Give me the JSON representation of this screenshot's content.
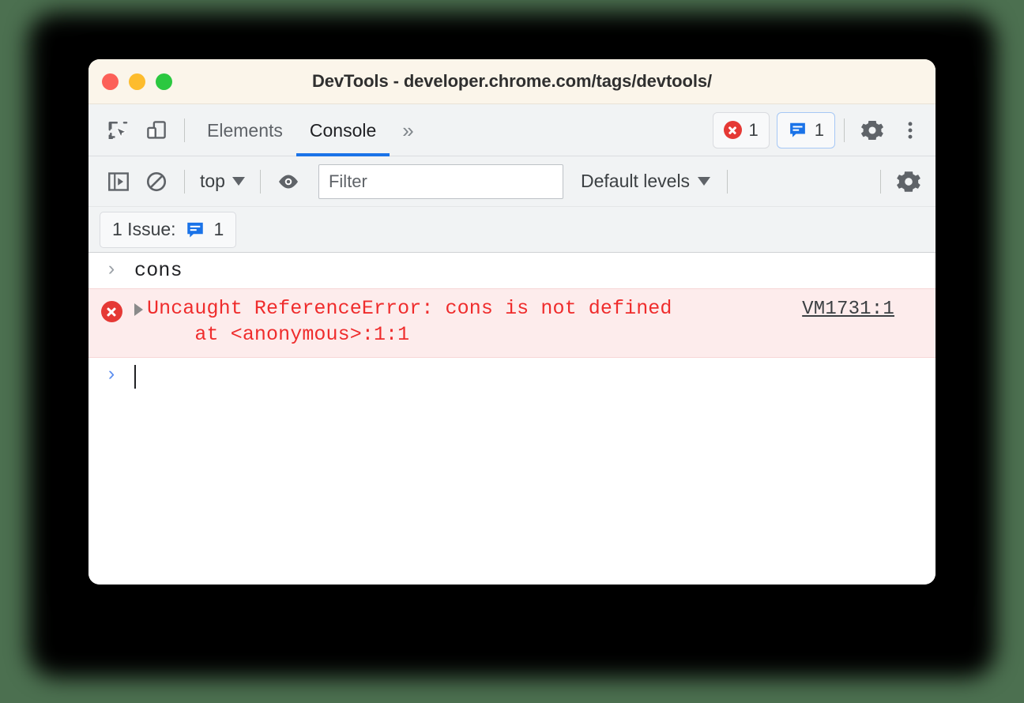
{
  "window": {
    "title": "DevTools - developer.chrome.com/tags/devtools/",
    "traffic_lights": [
      {
        "name": "close",
        "color": "#fc6058"
      },
      {
        "name": "minimize",
        "color": "#fdbc2d"
      },
      {
        "name": "maximize",
        "color": "#2bc840"
      }
    ]
  },
  "tabbar": {
    "inspect_icon": "inspect-element-icon",
    "device_icon": "device-toolbar-icon",
    "tabs": [
      {
        "label": "Elements",
        "active": false
      },
      {
        "label": "Console",
        "active": true
      }
    ],
    "overflow_label": "»",
    "error_badge": {
      "icon": "error-circle-icon",
      "count": "1"
    },
    "issues_badge": {
      "icon": "issues-speech-bubble-icon",
      "count": "1"
    },
    "settings_icon": "gear-icon",
    "more_icon": "kebab-menu-icon"
  },
  "console_toolbar": {
    "sidebar_icon": "console-sidebar-icon",
    "clear_icon": "clear-console-icon",
    "context": {
      "label": "top",
      "caret": "chevron-down-icon"
    },
    "eye_icon": "live-expression-eye-icon",
    "filter": {
      "placeholder": "Filter",
      "value": ""
    },
    "levels": {
      "label": "Default levels",
      "caret": "chevron-down-icon"
    },
    "settings_icon": "gear-icon"
  },
  "issues_bar": {
    "label": "1 Issue:",
    "icon": "issues-speech-bubble-icon",
    "count": "1"
  },
  "console": {
    "entries": [
      {
        "type": "input",
        "prompt": "›",
        "text": "cons"
      },
      {
        "type": "error",
        "icon": "error-circle-icon",
        "disclosure": "expand-triangle-icon",
        "message_line1": "Uncaught ReferenceError: cons is not defined",
        "message_line2": "    at <anonymous>:1:1",
        "source_link": "VM1731:1"
      },
      {
        "type": "prompt",
        "prompt": "›",
        "text": ""
      }
    ]
  },
  "colors": {
    "page_background": "#4c7050",
    "titlebar": "#fbf5ea",
    "toolbar": "#f1f3f4",
    "accent_blue": "#1a73e8",
    "error_red": "#ef2c2c",
    "error_row_background": "#fdecec",
    "prompt_blue": "#5b8def"
  }
}
